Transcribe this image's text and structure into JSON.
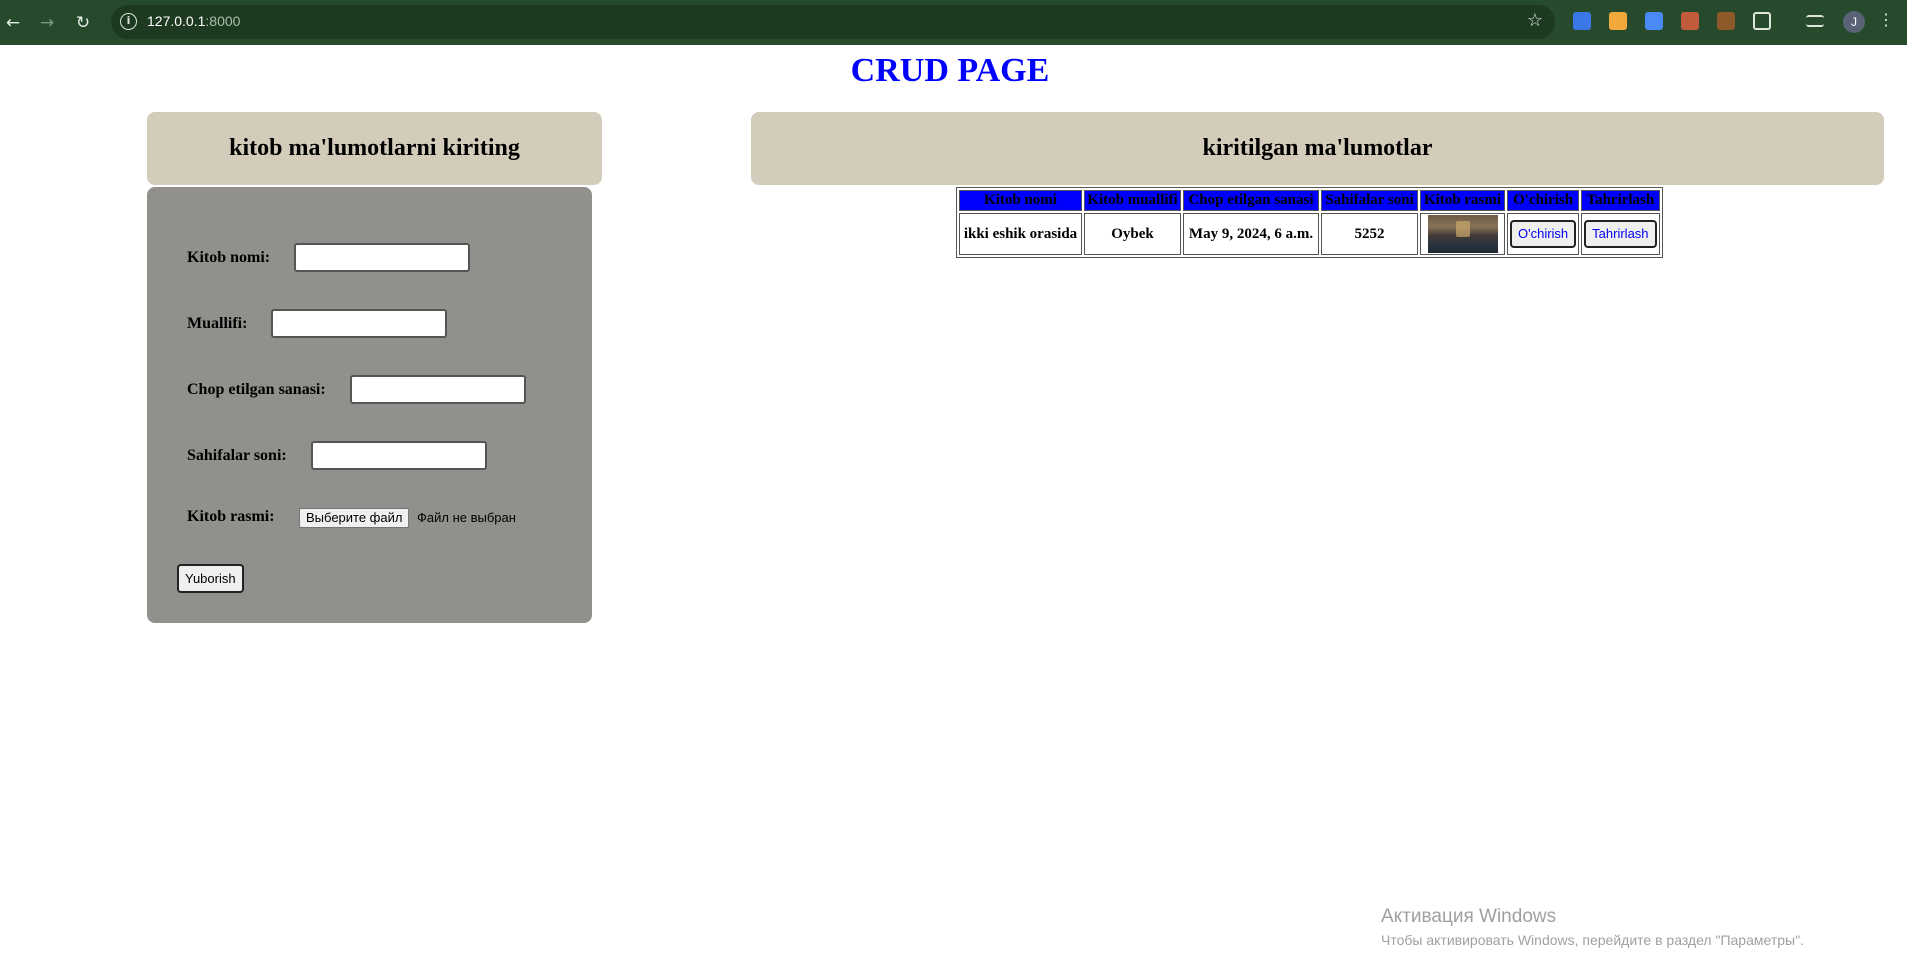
{
  "browser": {
    "url_host": "127.0.0.1",
    "url_port": ":8000",
    "profile_initial": "J"
  },
  "page": {
    "title": "CRUD PAGE"
  },
  "form_panel": {
    "header": "kitob ma'lumotlarni kiriting",
    "fields": {
      "title_label": "Kitob nomi:",
      "author_label": "Muallifi:",
      "date_label": "Chop etilgan sanasi:",
      "pages_label": "Sahifalar soni:",
      "image_label": "Kitob rasmi:"
    },
    "file_button": "Выберите файл",
    "file_status": "Файл не выбран",
    "submit": "Yuborish"
  },
  "table_panel": {
    "header": "kiritilgan ma'lumotlar",
    "columns": [
      "Kitob nomi",
      "Kitob muallifi",
      "Chop etilgan sanasi",
      "Sahifalar soni",
      "Kitob rasmi",
      "O'chirish",
      "Tahrirlash"
    ],
    "rows": [
      {
        "title": "ikki eshik orasida",
        "author": "Oybek",
        "date": "May 9, 2024, 6 a.m.",
        "pages": "5252",
        "delete_label": "O'chirish",
        "edit_label": "Tahrirlash"
      }
    ]
  },
  "watermark": {
    "title": "Активация Windows",
    "subtitle": "Чтобы активировать Windows, перейдите в раздел \"Параметры\"."
  },
  "colors": {
    "chrome_bg": "#264a2b",
    "title_blue": "#0000ff",
    "panel_header_bg": "#d3ccba",
    "form_bg": "#91908c",
    "table_header_bg": "#0000ff"
  }
}
